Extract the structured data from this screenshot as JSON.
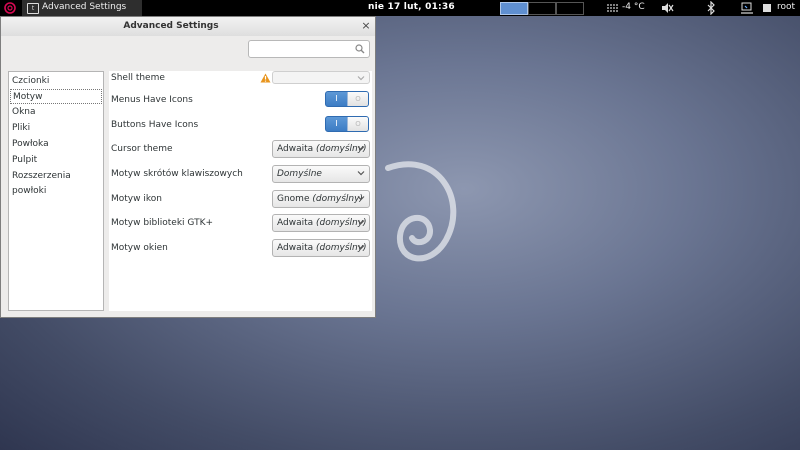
{
  "topbar": {
    "app_name": "Advanced Settings",
    "app_icon": "t",
    "clock": "nie 17 lut, 01:36",
    "temperature": "-4 °C",
    "user": "root"
  },
  "window": {
    "title": "Advanced Settings",
    "close": "×",
    "search_placeholder": ""
  },
  "sidebar": {
    "items": [
      {
        "label": "Czcionki"
      },
      {
        "label": "Motyw"
      },
      {
        "label": "Okna"
      },
      {
        "label": "Pliki"
      },
      {
        "label": "Powłoka"
      },
      {
        "label": "Pulpit"
      },
      {
        "label": "Rozszerzenia powłoki"
      }
    ],
    "selected": "Motyw"
  },
  "settings": {
    "shell_theme": {
      "label": "Shell theme",
      "value": ""
    },
    "menus_icons": {
      "label": "Menus Have Icons",
      "on_symbol": "I",
      "off_symbol": "O",
      "state": "on"
    },
    "buttons_icons": {
      "label": "Buttons Have Icons",
      "on_symbol": "I",
      "off_symbol": "O",
      "state": "on"
    },
    "cursor_theme": {
      "label": "Cursor theme",
      "value": "Adwaita",
      "suffix": "(domyślny)"
    },
    "keys_theme": {
      "label": "Motyw skrótów klawiszowych",
      "value": "",
      "suffix": "Domyślne"
    },
    "icon_theme": {
      "label": "Motyw ikon",
      "value": "Gnome",
      "suffix": "(domyślny)"
    },
    "gtk_theme": {
      "label": "Motyw biblioteki GTK+",
      "value": "Adwaita",
      "suffix": "(domyślny)"
    },
    "window_theme": {
      "label": "Motyw okien",
      "value": "Adwaita",
      "suffix": "(domyślny)"
    }
  },
  "colors": {
    "accent": "#3c7cc4",
    "warning": "#e8951e",
    "topbar": "#000000"
  }
}
